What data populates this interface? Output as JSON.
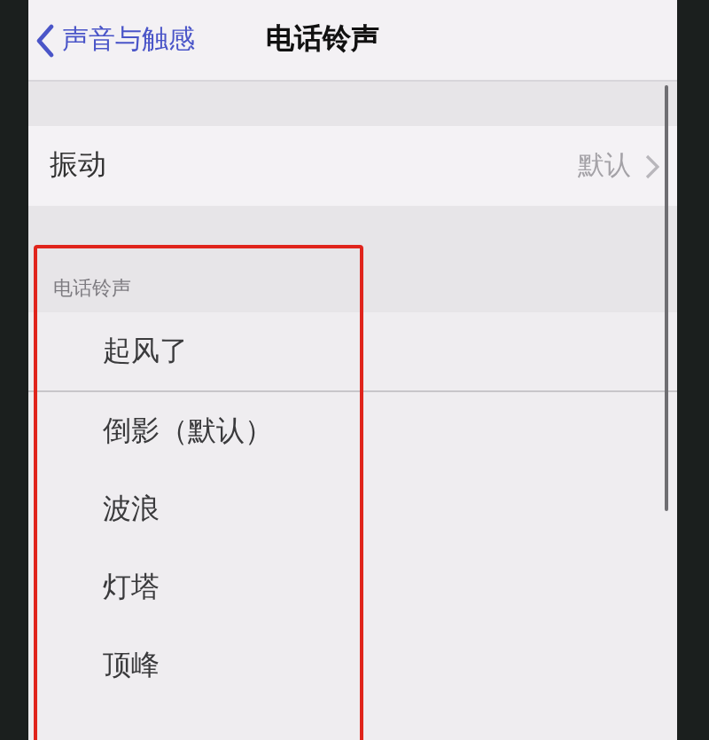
{
  "nav_bar": {
    "back_label": "声音与触感",
    "title": "电话铃声"
  },
  "vibration_row": {
    "label": "振动",
    "value": "默认"
  },
  "ringtones": {
    "header": "电话铃声",
    "items": [
      {
        "label": "起风了"
      },
      {
        "label": "倒影（默认）"
      },
      {
        "label": "波浪"
      },
      {
        "label": "灯塔"
      },
      {
        "label": "顶峰"
      }
    ]
  }
}
